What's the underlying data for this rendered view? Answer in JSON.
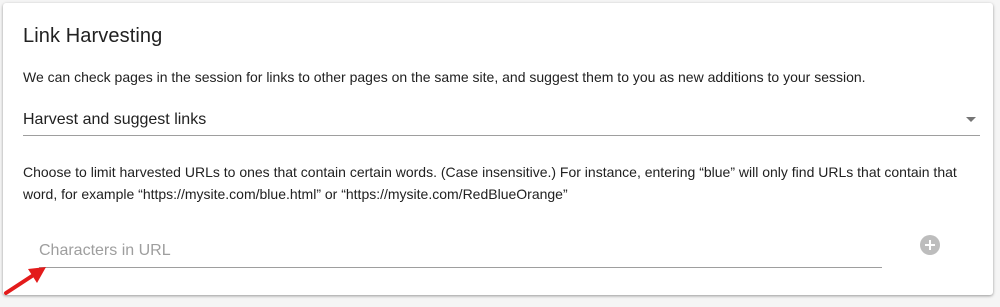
{
  "section": {
    "title": "Link Harvesting",
    "description": "We can check pages in the session for links to other pages on the same site, and suggest them to you as new additions to your session."
  },
  "harvest_select": {
    "selected": "Harvest and suggest links"
  },
  "filter": {
    "help_text": "Choose to limit harvested URLs to ones that contain certain words. (Case insensitive.) For instance, entering “blue” will only find URLs that contain that word, for example “https://mysite.com/blue.html” or “https://mysite.com/RedBlueOrange”",
    "url_input_value": "",
    "url_input_placeholder": "Characters in URL"
  },
  "icons": {
    "add": "plus-circle-icon",
    "dropdown": "chevron-down-icon",
    "annotation": "red-arrow-icon"
  },
  "colors": {
    "annotation_arrow": "#e31b1b",
    "add_button": "#bdbdbd",
    "text": "#212121",
    "placeholder": "#9e9e9e"
  }
}
